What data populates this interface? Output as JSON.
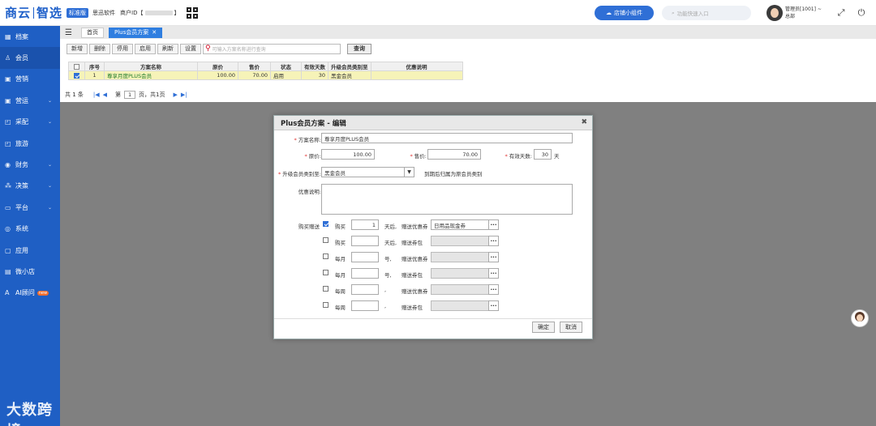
{
  "header": {
    "logo_left": "商云",
    "logo_right": "智选",
    "edition_badge": "标准版",
    "brand_sub": "思迅软件",
    "merchant_label": "商户ID【",
    "merchant_suffix": "】",
    "widget_button": "店铺小组件",
    "search_placeholder": "功能快速入口",
    "user_name": "管理员[1001] ~",
    "user_org": "总部"
  },
  "sidebar": {
    "items": [
      {
        "label": "档案",
        "icon": "archive-icon",
        "glyph": "▦",
        "chevron": false
      },
      {
        "label": "会员",
        "icon": "member-icon",
        "glyph": "♙",
        "chevron": false
      },
      {
        "label": "营销",
        "icon": "marketing-icon",
        "glyph": "▣",
        "chevron": false
      },
      {
        "label": "营运",
        "icon": "operation-icon",
        "glyph": "▣",
        "chevron": true
      },
      {
        "label": "采配",
        "icon": "purchase-icon",
        "glyph": "◰",
        "chevron": true
      },
      {
        "label": "旅游",
        "icon": "travel-icon",
        "glyph": "◰",
        "chevron": false
      },
      {
        "label": "财务",
        "icon": "finance-icon",
        "glyph": "◉",
        "chevron": true
      },
      {
        "label": "决策",
        "icon": "decision-icon",
        "glyph": "⁂",
        "chevron": true
      },
      {
        "label": "平台",
        "icon": "platform-icon",
        "glyph": "▭",
        "chevron": true
      },
      {
        "label": "系统",
        "icon": "system-icon",
        "glyph": "◎",
        "chevron": false
      },
      {
        "label": "应用",
        "icon": "app-icon",
        "glyph": "▢",
        "chevron": false
      },
      {
        "label": "微小店",
        "icon": "shop-icon",
        "glyph": "▤",
        "chevron": false
      },
      {
        "label": "AI顾问",
        "icon": "ai-icon",
        "glyph": "A",
        "chevron": false,
        "badge": "new"
      }
    ],
    "watermark": "大数跨境"
  },
  "tabs": [
    {
      "label": "首页"
    },
    {
      "label": "Plus会员方案"
    }
  ],
  "toolbar": {
    "buttons": [
      "新增",
      "删除",
      "停用",
      "启用",
      "刷新",
      "设置"
    ],
    "search_placeholder": "可输入方案名称进行查询",
    "query_label": "查询"
  },
  "table": {
    "columns": [
      "序号",
      "方案名称",
      "原价",
      "售价",
      "状态",
      "有效天数",
      "升级会员类别至",
      "优惠说明"
    ],
    "rows": [
      {
        "index": "1",
        "name": "尊享月度PLUS会员",
        "orig": "100.00",
        "price": "70.00",
        "status": "启用",
        "days": "30",
        "level": "黑金会员",
        "desc": ""
      }
    ]
  },
  "pager": {
    "total": "共 1 条",
    "page_prefix": "第",
    "page": "1",
    "page_suffix": "页，共1页"
  },
  "dialog": {
    "title": "Plus会员方案 - 编辑",
    "name_label": "方案名称:",
    "name_value": "尊享月度PLUS会员",
    "orig_label": "原价:",
    "orig_value": "100.00",
    "price_label": "售价:",
    "price_value": "70.00",
    "days_label": "有效天数:",
    "days_value": "30",
    "days_unit": "天",
    "level_label": "升级会员类别至:",
    "level_value": "黑金会员",
    "level_hint": "到期后归属为原会员类别",
    "desc_label": "优惠说明:",
    "gift_label": "购买赠送",
    "gift_rows": [
      {
        "checked": true,
        "kind": "购买",
        "num": "1",
        "unit": "天后,",
        "gift": "赠送优惠券",
        "value": "日用品现金券"
      },
      {
        "checked": false,
        "kind": "购买",
        "num": "",
        "unit": "天后,",
        "gift": "赠送券包",
        "value": ""
      },
      {
        "checked": false,
        "kind": "每月",
        "num": "",
        "unit": "号,",
        "gift": "赠送优惠券",
        "value": ""
      },
      {
        "checked": false,
        "kind": "每月",
        "num": "",
        "unit": "号,",
        "gift": "赠送券包",
        "value": ""
      },
      {
        "checked": false,
        "kind": "每周",
        "num": "",
        "unit": ",",
        "gift": "赠送优惠券",
        "value": ""
      },
      {
        "checked": false,
        "kind": "每周",
        "num": "",
        "unit": ",",
        "gift": "赠送券包",
        "value": ""
      }
    ],
    "ok_label": "确定",
    "cancel_label": "取消"
  }
}
